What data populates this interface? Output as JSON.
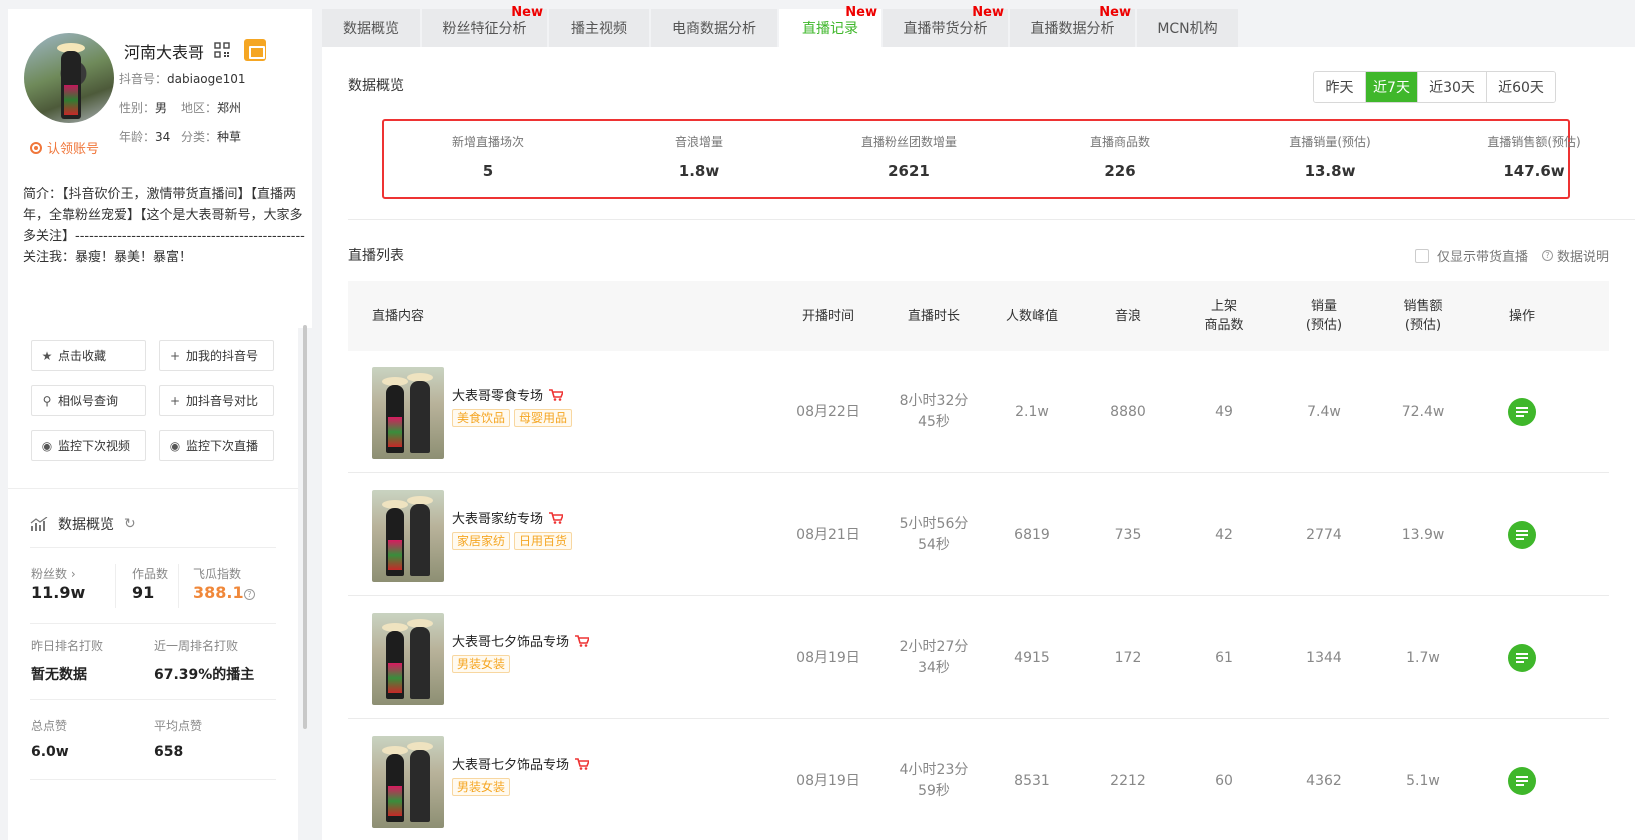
{
  "profile": {
    "name": "河南大表哥",
    "douyin_id_label": "抖音号：",
    "douyin_id": "dabiaoge101",
    "gender_label": "性别：",
    "gender": "男",
    "region_label": "地区：",
    "region": "郑州",
    "age_label": "年龄：",
    "age": "34",
    "category_label": "分类：",
    "category": "种草",
    "verify_label": "认领账号",
    "bio": "简介：【抖音砍价王，激情带货直播间】【直播两年，全靠粉丝宠爱】【这个是大表哥新号，大家多多关注】-------------------------------------------------关注我：暴瘦！暴美！暴富！"
  },
  "actions": {
    "favorite": "点击收藏",
    "add_my": "加我的抖音号",
    "similar": "相似号查询",
    "compare": "加抖音号对比",
    "monitor_video": "监控下次视频",
    "monitor_live": "监控下次直播"
  },
  "overview_left": {
    "title": "数据概览",
    "fans_label": "粉丝数",
    "fans": "11.9w",
    "works_label": "作品数",
    "works": "91",
    "index_label": "飞瓜指数",
    "index": "388.1",
    "yday_rank_label": "昨日排名打败",
    "yday_rank": "暂无数据",
    "week_rank_label": "近一周排名打败",
    "week_rank": "67.39%的播主",
    "likes_label": "总点赞",
    "likes": "6.0w",
    "avg_likes_label": "平均点赞",
    "avg_likes": "658"
  },
  "tabs": [
    {
      "label": "数据概览",
      "new": ""
    },
    {
      "label": "粉丝特征分析",
      "new": "New"
    },
    {
      "label": "播主视频",
      "new": ""
    },
    {
      "label": "电商数据分析",
      "new": ""
    },
    {
      "label": "直播记录",
      "new": "New"
    },
    {
      "label": "直播带货分析",
      "new": "New"
    },
    {
      "label": "直播数据分析",
      "new": "New"
    },
    {
      "label": "MCN机构",
      "new": ""
    }
  ],
  "summary": {
    "title": "数据概览",
    "ranges": [
      "昨天",
      "近7天",
      "近30天",
      "近60天"
    ],
    "items": [
      {
        "label": "新增直播场次",
        "value": "5"
      },
      {
        "label": "音浪增量",
        "value": "1.8w"
      },
      {
        "label": "直播粉丝团数增量",
        "value": "2621"
      },
      {
        "label": "直播商品数",
        "value": "226"
      },
      {
        "label": "直播销量(预估)",
        "value": "13.8w"
      },
      {
        "label": "直播销售额(预估)",
        "value": "147.6w"
      }
    ]
  },
  "list": {
    "title": "直播列表",
    "only_label": "仅显示带货直播",
    "help_label": "数据说明",
    "columns": {
      "content": "直播内容",
      "start": "开播时间",
      "duration": "直播时长",
      "peak": "人数峰值",
      "sound": "音浪",
      "goods_1": "上架",
      "goods_2": "商品数",
      "sales_1": "销量",
      "sales_2": "(预估)",
      "amount_1": "销售额",
      "amount_2": "(预估)",
      "op": "操作"
    },
    "rows": [
      {
        "title": "大表哥零食专场",
        "tags": [
          "美食饮品",
          "母婴用品"
        ],
        "date": "08月22日",
        "dur1": "8小时32分",
        "dur2": "45秒",
        "peak": "2.1w",
        "sound": "8880",
        "goods": "49",
        "sales": "7.4w",
        "amount": "72.4w"
      },
      {
        "title": "大表哥家纺专场",
        "tags": [
          "家居家纺",
          "日用百货"
        ],
        "date": "08月21日",
        "dur1": "5小时56分",
        "dur2": "54秒",
        "peak": "6819",
        "sound": "735",
        "goods": "42",
        "sales": "2774",
        "amount": "13.9w"
      },
      {
        "title": "大表哥七夕饰品专场",
        "tags": [
          "男装女装"
        ],
        "date": "08月19日",
        "dur1": "2小时27分",
        "dur2": "34秒",
        "peak": "4915",
        "sound": "172",
        "goods": "61",
        "sales": "1344",
        "amount": "1.7w"
      },
      {
        "title": "大表哥七夕饰品专场",
        "tags": [
          "男装女装"
        ],
        "date": "08月19日",
        "dur1": "4小时23分",
        "dur2": "59秒",
        "peak": "8531",
        "sound": "2212",
        "goods": "60",
        "sales": "4362",
        "amount": "5.1w"
      }
    ]
  },
  "colors": {
    "accent": "#3fb72b",
    "highlight_border": "#ee3333",
    "new_badge": "#ee0000",
    "index_orange": "#f0883a"
  }
}
